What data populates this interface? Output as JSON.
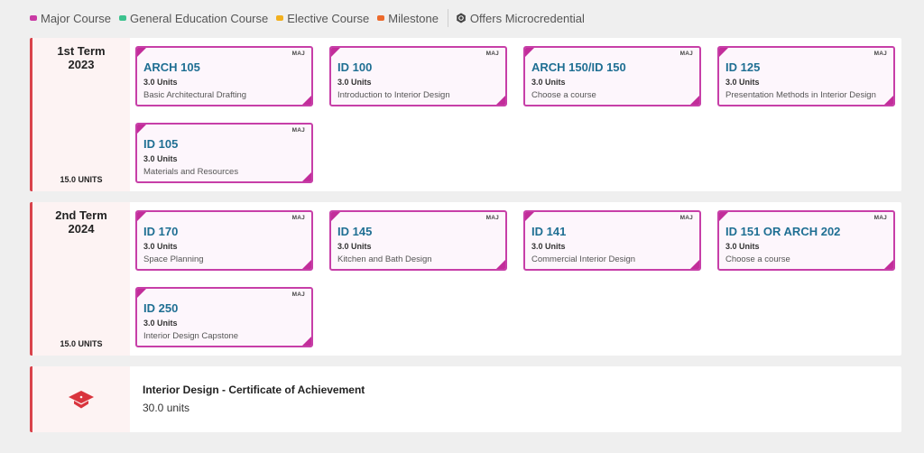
{
  "legend": {
    "items": [
      {
        "label": "Major Course",
        "color": "#c93aa4"
      },
      {
        "label": "General Education Course",
        "color": "#3cc28e"
      },
      {
        "label": "Elective Course",
        "color": "#f2b01e"
      },
      {
        "label": "Milestone",
        "color": "#ec6a2c"
      }
    ],
    "microcredential_label": "Offers Microcredential"
  },
  "terms": [
    {
      "name_line1": "1st Term",
      "name_line2": "2023",
      "units": "15.0 UNITS",
      "courses": [
        {
          "tag": "MAJ",
          "code": "ARCH 105",
          "units": "3.0 Units",
          "title": "Basic Architectural Drafting"
        },
        {
          "tag": "MAJ",
          "code": "ID 100",
          "units": "3.0 Units",
          "title": "Introduction to Interior Design"
        },
        {
          "tag": "MAJ",
          "code": "ARCH 150/ID 150",
          "units": "3.0 Units",
          "title": "Choose a course"
        },
        {
          "tag": "MAJ",
          "code": "ID 125",
          "units": "3.0 Units",
          "title": "Presentation Methods in Interior Design"
        },
        {
          "tag": "MAJ",
          "code": "ID 105",
          "units": "3.0 Units",
          "title": "Materials and Resources"
        }
      ]
    },
    {
      "name_line1": "2nd Term",
      "name_line2": "2024",
      "units": "15.0 UNITS",
      "courses": [
        {
          "tag": "MAJ",
          "code": "ID 170",
          "units": "3.0 Units",
          "title": "Space Planning"
        },
        {
          "tag": "MAJ",
          "code": "ID 145",
          "units": "3.0 Units",
          "title": "Kitchen and Bath Design"
        },
        {
          "tag": "MAJ",
          "code": "ID 141",
          "units": "3.0 Units",
          "title": "Commercial Interior Design"
        },
        {
          "tag": "MAJ",
          "code": "ID 151 OR ARCH 202",
          "units": "3.0 Units",
          "title": "Choose a course"
        },
        {
          "tag": "MAJ",
          "code": "ID 250",
          "units": "3.0 Units",
          "title": "Interior Design Capstone"
        }
      ]
    }
  ],
  "certificate": {
    "icon": "graduation-cap-icon",
    "title": "Interior Design - Certificate of Achievement",
    "units": "30.0 units"
  }
}
